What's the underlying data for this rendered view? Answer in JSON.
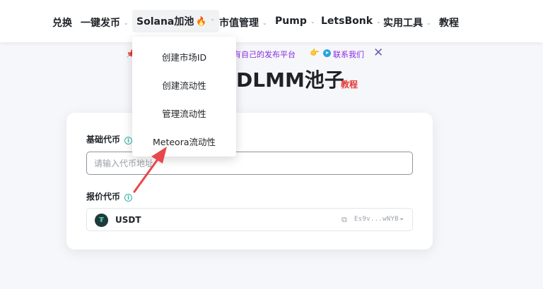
{
  "nav": {
    "items": [
      {
        "label": "兑换",
        "has_chevron": false
      },
      {
        "label": "一键发币",
        "has_chevron": true
      },
      {
        "label": "Solana加池",
        "has_chevron": true,
        "active": true,
        "badge_icon": "flame-icon"
      },
      {
        "label": "市值管理",
        "has_chevron": true
      },
      {
        "label": "Pump",
        "has_chevron": true
      },
      {
        "label": "LetsBonk",
        "has_chevron": true
      },
      {
        "label": "实用工具",
        "has_chevron": true
      },
      {
        "label": "教程",
        "has_chevron": false
      }
    ]
  },
  "dropdown": {
    "items": [
      "创建市场ID",
      "创建流动性",
      "管理流动性",
      "Meteora流动性"
    ]
  },
  "banner": {
    "text": "有自己的发布平台",
    "contact": "联系我们",
    "icons": [
      "pin-icon",
      "pointing-hand-icon",
      "telegram-icon",
      "close-icon"
    ]
  },
  "page": {
    "title": "DLMM池子",
    "tutorial_link": "教程"
  },
  "form": {
    "base_token_label": "基础代币",
    "base_token_placeholder": "请输入代币地址",
    "quote_token_label": "报价代币",
    "quote_token": {
      "symbol": "USDT",
      "address": "Es9v...wNYB"
    }
  },
  "colors": {
    "accent_teal": "#2db3a6",
    "banner_purple": "#8a2be2",
    "tutorial_red": "#e53935",
    "annotation_arrow": "#e8474c"
  }
}
